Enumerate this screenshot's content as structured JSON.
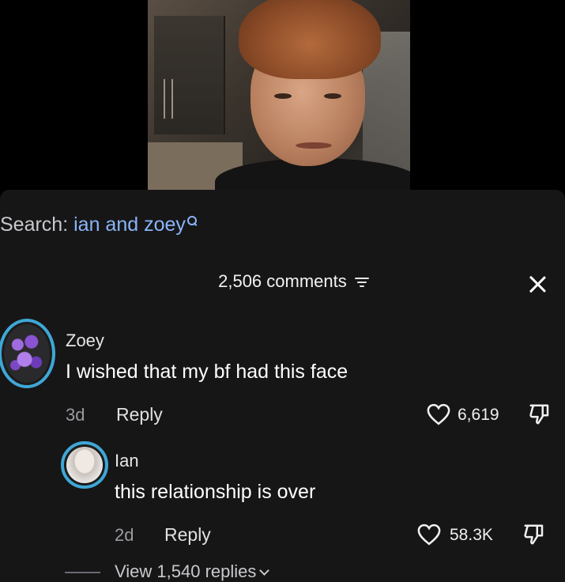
{
  "search": {
    "prefix": "Search:",
    "query": "ian and zoey"
  },
  "header": {
    "comments_count": "2,506 comments"
  },
  "comments": [
    {
      "username": "Zoey",
      "text": "I wished that my bf had this face",
      "time": "3d",
      "reply_label": "Reply",
      "likes": "6,619"
    },
    {
      "username": "Ian",
      "text": "this relationship is over",
      "time": "2d",
      "reply_label": "Reply",
      "likes": "58.3K"
    }
  ],
  "view_replies": "View 1,540 replies",
  "colors": {
    "accent_ring": "#3fa7d6",
    "search_query": "#8ab4f8",
    "panel_bg": "#161617"
  }
}
